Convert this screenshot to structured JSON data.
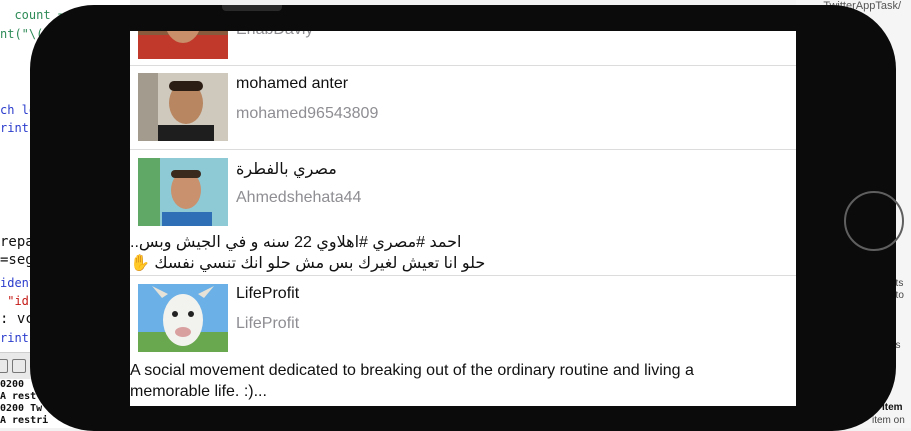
{
  "editor": {
    "lines": [
      {
        "text": "  count =",
        "cls": "c-green"
      },
      {
        "text": "nt(\"\\(",
        "cls": "c-green"
      },
      {
        "text": "ch lo",
        "cls": "c-blue"
      },
      {
        "text": "rint",
        "cls": "c-blue"
      },
      {
        "text": "repa",
        "cls": "c-black"
      },
      {
        "text": "=seg",
        "cls": "c-black"
      },
      {
        "text": "ident",
        "cls": "c-blue"
      },
      {
        "text": " \"idi",
        "cls": "c-red"
      },
      {
        "text": ": vc",
        "cls": "c-black"
      },
      {
        "text": "rint",
        "cls": "c-blue"
      }
    ],
    "console": [
      "0200",
      "A rest",
      "0200 Tw",
      "A restri"
    ]
  },
  "right_panel": {
    "top_label": "TwitterAppTask/",
    "snippet_1": "nts",
    "snippet_2": "t to a",
    "snippet_3": "as",
    "item_title": "Item",
    "item_sub": "item on"
  },
  "feed": {
    "top_partial_handle": "EhabDaviy",
    "users": [
      {
        "name": "mohamed anter",
        "handle": "mohamed96543809"
      },
      {
        "name": "مصري بالفطرة",
        "handle": "Ahmedshehata44",
        "description_line1": "احمد #مصري #اهلاوي 22 سنه و في الجيش وبس..",
        "description_line2": "حلو انا تعيش لغيرك بس مش حلو انك تنسي نفسك",
        "description_emoji": "✋"
      },
      {
        "name": "LifeProfit",
        "handle": "LifeProfit",
        "description_line1": "A social movement dedicated to breaking out of the ordinary routine and living a",
        "description_line2": "memorable life. :)..."
      }
    ]
  },
  "colors": {
    "frame": "#0b0b0b",
    "handle_gray": "#8e8e93",
    "separator": "#dcdcdc"
  }
}
